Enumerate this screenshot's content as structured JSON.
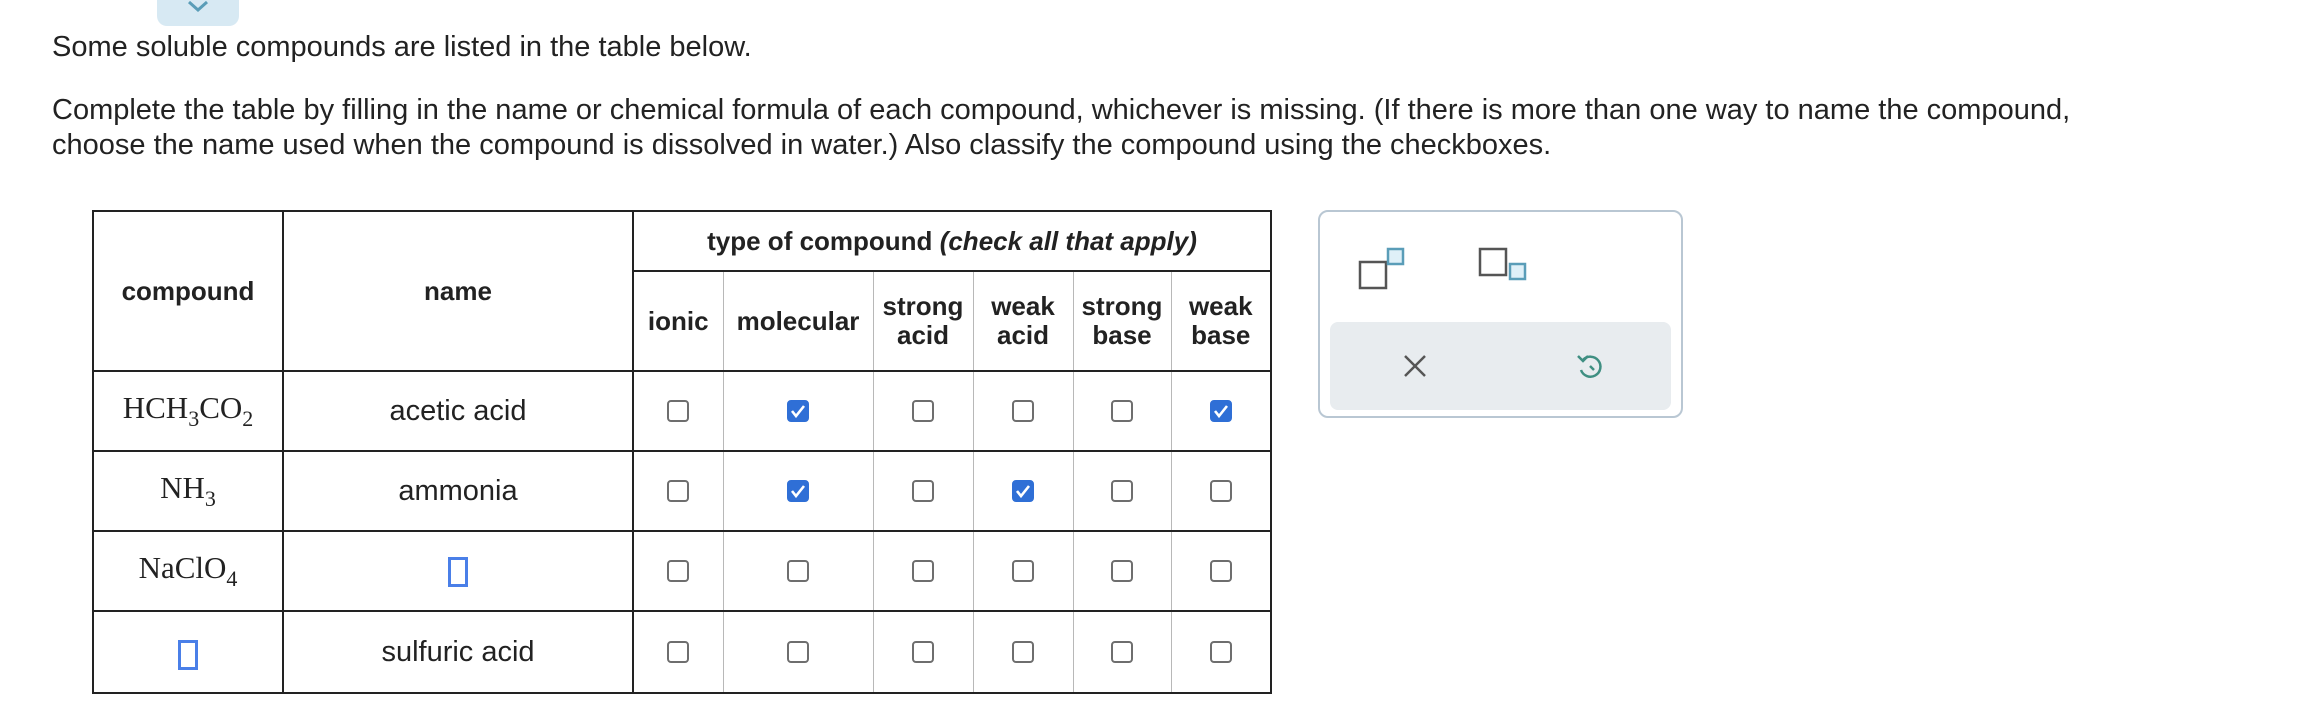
{
  "intro_text": "Some soluble compounds are listed in the table below.",
  "instructions_text": "Complete the table by filling in the name or chemical formula of each compound, whichever is missing. (If there is more than one way to name the compound,\nchoose the name used when the compound is dissolved in water.) Also classify the compound using the checkboxes.",
  "table": {
    "headers": {
      "compound": "compound",
      "name": "name",
      "group_main": "type of compound",
      "group_hint": "(check all that apply)",
      "ionic": "ionic",
      "molecular": "molecular",
      "strong_acid_1": "strong",
      "strong_acid_2": "acid",
      "weak_acid_1": "weak",
      "weak_acid_2": "acid",
      "strong_base_1": "strong",
      "strong_base_2": "base",
      "weak_base_1": "weak",
      "weak_base_2": "base"
    },
    "rows": [
      {
        "formula_parts": [
          "HCH",
          "3",
          "CO",
          "2"
        ],
        "name": "acetic acid",
        "checks": {
          "ionic": false,
          "molecular": true,
          "strong_acid": false,
          "weak_acid": false,
          "strong_base": false,
          "weak_base": true
        }
      },
      {
        "formula_parts": [
          "NH",
          "3"
        ],
        "name": "ammonia",
        "checks": {
          "ionic": false,
          "molecular": true,
          "strong_acid": false,
          "weak_acid": true,
          "strong_base": false,
          "weak_base": false
        }
      },
      {
        "formula_parts": [
          "NaClO",
          "4"
        ],
        "name": "",
        "checks": {
          "ionic": false,
          "molecular": false,
          "strong_acid": false,
          "weak_acid": false,
          "strong_base": false,
          "weak_base": false
        }
      },
      {
        "formula_parts": [],
        "name": "sulfuric acid",
        "checks": {
          "ionic": false,
          "molecular": false,
          "strong_acid": false,
          "weak_acid": false,
          "strong_base": false,
          "weak_base": false
        }
      }
    ]
  },
  "panel": {
    "icons": [
      "superscript-template-icon",
      "subscript-template-icon",
      "clear-x-icon",
      "undo-icon"
    ]
  },
  "colors": {
    "checkbox_checked": "#2f6fd6",
    "answer_slot": "#4a7fe8",
    "panel_border": "#b9c7d3",
    "panel_button_bar": "#e8ecef",
    "icon_teal": "#5a9db8"
  }
}
